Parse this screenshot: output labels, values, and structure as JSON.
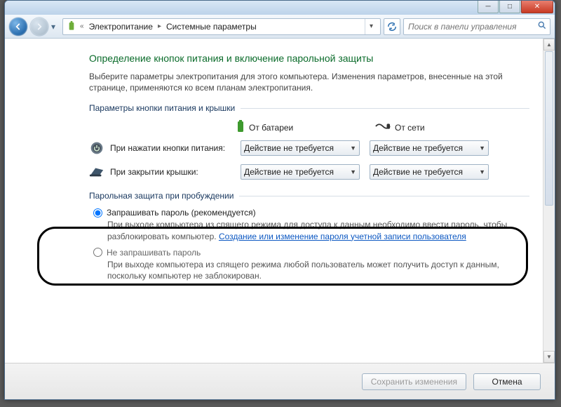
{
  "titlebar": {
    "min": "─",
    "max": "□",
    "close": "✕"
  },
  "nav": {
    "breadcrumb_root_sep": "«",
    "breadcrumb_item1": "Электропитание",
    "breadcrumb_item2": "Системные параметры",
    "search_placeholder": "Поиск в панели управления"
  },
  "page": {
    "title": "Определение кнопок питания и включение парольной защиты",
    "lead": "Выберите параметры электропитания для этого компьютера. Изменения параметров, внесенные на этой странице, применяются ко всем планам электропитания."
  },
  "group1": {
    "label": "Параметры кнопки питания и крышки",
    "col_battery": "От батареи",
    "col_ac": "От сети",
    "row_power_button": "При нажатии кнопки питания:",
    "row_lid_close": "При закрытии крышки:",
    "combo_value": "Действие не требуется"
  },
  "group2": {
    "label": "Парольная защита при пробуждении",
    "radio1_label": "Запрашивать пароль (рекомендуется)",
    "radio1_desc_a": "При выходе компьютера из спящего режима для доступа к данным необходимо ввести пароль, чтобы разблокировать компьютер. ",
    "radio1_link": "Создание или изменение пароля учетной записи пользователя",
    "radio2_label": "Не запрашивать пароль",
    "radio2_desc": "При выходе компьютера из спящего режима любой пользователь может получить доступ к данным, поскольку компьютер не заблокирован."
  },
  "footer": {
    "save": "Сохранить изменения",
    "cancel": "Отмена"
  }
}
